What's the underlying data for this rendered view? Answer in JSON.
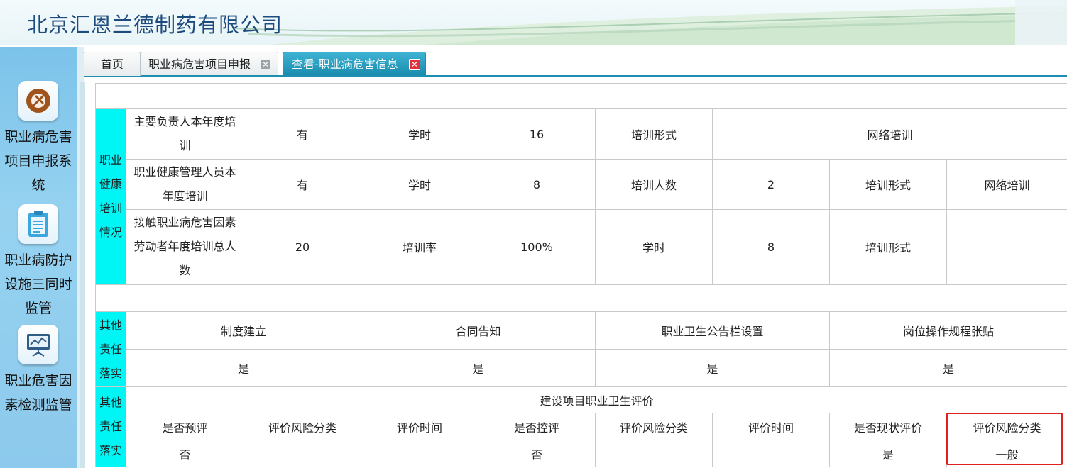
{
  "header": {
    "company_name": "北京汇恩兰德制药有限公司"
  },
  "sidebar": {
    "items": [
      {
        "label": "职业病危害项目申报系统",
        "icon": "tools-icon"
      },
      {
        "label": "职业病防护设施三同时监管",
        "icon": "clipboard-icon"
      },
      {
        "label": "职业危害因素检测监管",
        "icon": "monitor-chart-icon"
      }
    ]
  },
  "tabs": [
    {
      "label": "首页"
    },
    {
      "label": "职业病危害项目申报",
      "close": "×"
    },
    {
      "label": "查看-职业病危害信息",
      "close": "×"
    }
  ],
  "training": {
    "section_label": "职业健康培训情况",
    "row1": {
      "item": "主要负责人本年度培训",
      "value": "有",
      "hours_label": "学时",
      "hours": "16",
      "form_label": "培训形式",
      "form": "网络培训"
    },
    "row2": {
      "item": "职业健康管理人员本年度培训",
      "value": "有",
      "hours_label": "学时",
      "hours": "8",
      "count_label": "培训人数",
      "count": "2",
      "form_label": "培训形式",
      "form": "网络培训"
    },
    "row3": {
      "item": "接触职业病危害因素劳动者年度培训总人数",
      "value": "20",
      "rate_label": "培训率",
      "rate": "100%",
      "hours_label": "学时",
      "hours": "8",
      "form_label": "培训形式",
      "form": ""
    }
  },
  "responsibility": {
    "section_label": "其他责任落实",
    "headers": [
      "制度建立",
      "合同告知",
      "职业卫生公告栏设置",
      "岗位操作规程张贴"
    ],
    "values": [
      "是",
      "是",
      "是",
      "是"
    ]
  },
  "evaluation": {
    "section_label": "其他责任落实",
    "title": "建设项目职业卫生评价",
    "headers": [
      "是否预评",
      "评价风险分类",
      "评价时间",
      "是否控评",
      "评价风险分类",
      "评价时间",
      "是否现状评价",
      "评价风险分类"
    ],
    "values": [
      "否",
      "",
      "",
      "否",
      "",
      "",
      "是",
      "一般"
    ]
  },
  "colors": {
    "accent": "#1e8fb0",
    "section_bg": "#00f5f5",
    "highlight": "#e0201f"
  }
}
